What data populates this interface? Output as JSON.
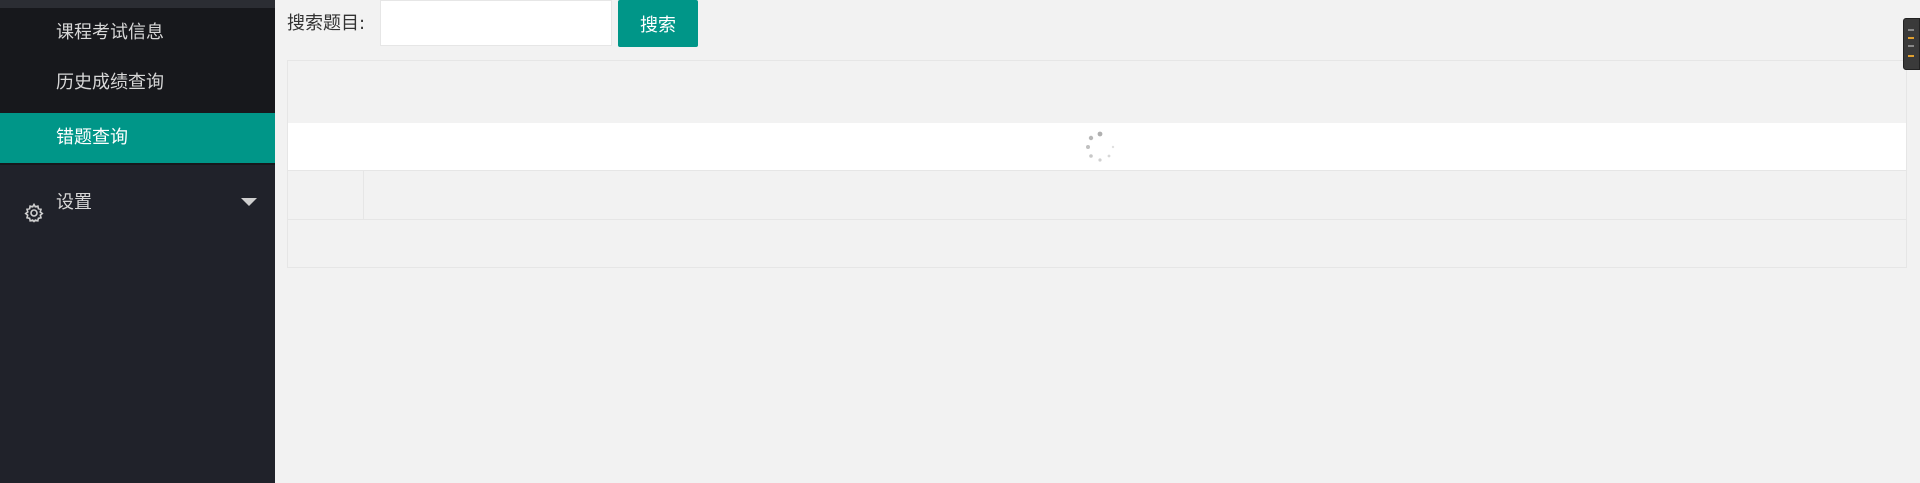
{
  "sidebar": {
    "sub_items": [
      {
        "label": "课程考试信息",
        "active": false
      },
      {
        "label": "历史成绩查询",
        "active": false
      },
      {
        "label": "错题查询",
        "active": true
      }
    ],
    "settings": {
      "label": "设置",
      "icon": "gear-icon",
      "expand_icon": "caret-down-icon"
    }
  },
  "search": {
    "label": "搜索题目:",
    "input_value": "",
    "placeholder": "",
    "button_label": "搜索"
  },
  "table": {
    "state": "loading",
    "loading_icon": "loading-spinner-icon"
  },
  "colors": {
    "accent": "#009688",
    "sidebar_bg": "#20222a",
    "submenu_bg": "#17181c",
    "page_bg": "#f2f2f2"
  }
}
